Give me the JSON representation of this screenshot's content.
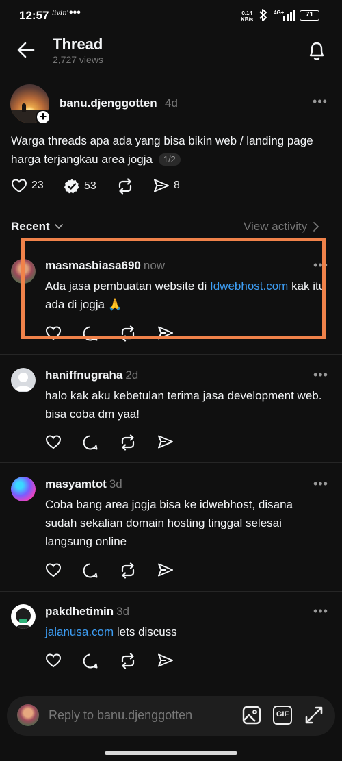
{
  "status_bar": {
    "time": "12:57",
    "brand": "livin'",
    "dots": "•••",
    "net_speed_value": "0.14",
    "net_speed_unit": "KB/s",
    "network": "4G+",
    "battery": "71"
  },
  "header": {
    "title": "Thread",
    "views": "2,727 views"
  },
  "original_post": {
    "username": "banu.djenggotten",
    "time": "4d",
    "text": "Warga threads apa ada yang bisa bikin web / landing page harga terjangkau area jogja",
    "pagination": "1/2",
    "likes": "23",
    "replies": "53",
    "shares": "8"
  },
  "recent": {
    "label": "Recent",
    "view_activity": "View activity"
  },
  "replies": [
    {
      "username": "masmasbiasa690",
      "time": "now",
      "text_before": "Ada jasa pembuatan website di ",
      "link": "Idwebhost.com",
      "text_after": " kak itu ada di jogja 🙏"
    },
    {
      "username": "haniffnugraha",
      "time": "2d",
      "text": "halo kak aku kebetulan terima jasa development web. bisa coba dm yaa!"
    },
    {
      "username": "masyamtot",
      "time": "3d",
      "text": "Coba bang area jogja bisa ke idwebhost, disana sudah sekalian domain hosting tinggal selesai langsung online"
    },
    {
      "username": "pakdhetimin",
      "time": "3d",
      "link": "jalanusa.com",
      "text_after": " lets discuss"
    }
  ],
  "reply_bar": {
    "placeholder": "Reply to banu.djenggotten",
    "gif_label": "GIF"
  },
  "colors": {
    "background": "#101010",
    "link": "#3d9df3",
    "highlight": "#f0824a",
    "muted": "#777777"
  },
  "icons": [
    "back-arrow-icon",
    "bell-icon",
    "heart-icon",
    "reply-bubble-icon",
    "repost-icon",
    "share-icon",
    "chevron-down-icon",
    "chevron-right-icon",
    "image-icon",
    "expand-icon",
    "more-icon"
  ]
}
